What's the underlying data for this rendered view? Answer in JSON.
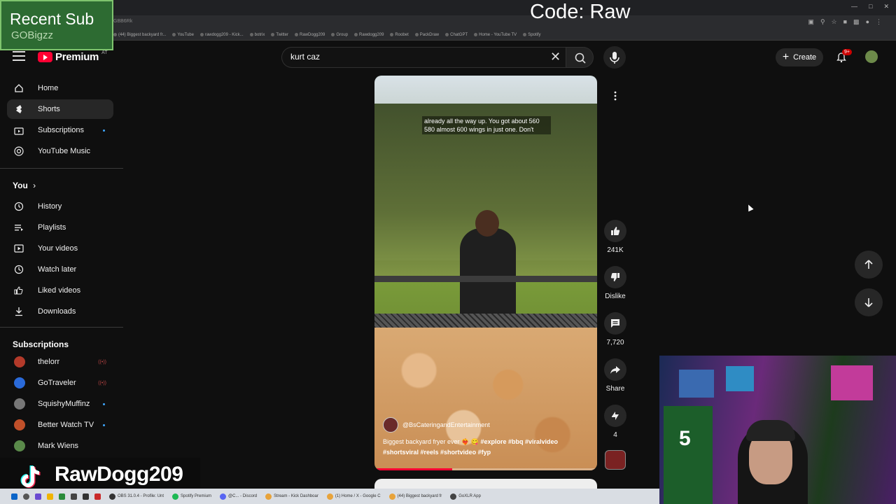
{
  "browser": {
    "url": "GBB6Rk",
    "bookmarks": [
      "(44) Biggest backyard fr...",
      "YouTube",
      "rawdogg209 - Kick...",
      "botrix",
      "Twitter",
      "RawDogg209",
      "Group",
      "Rawdogg209",
      "Roobet",
      "PackDraw",
      "ChatGPT",
      "Home - YouTube TV",
      "Spotify"
    ]
  },
  "overlays": {
    "recent_sub_title": "Recent Sub",
    "recent_sub_name": "GOBigzz",
    "code_label": "Code: Raw",
    "tiktok_handle": "RawDogg209"
  },
  "header": {
    "logo_text": "Premium",
    "region": "AT",
    "search_value": "kurt caz",
    "create_label": "Create",
    "notif_count": "9+"
  },
  "sidebar": {
    "main": [
      {
        "label": "Home",
        "icon": "home-icon"
      },
      {
        "label": "Shorts",
        "icon": "shorts-icon"
      },
      {
        "label": "Subscriptions",
        "icon": "subscriptions-icon"
      },
      {
        "label": "YouTube Music",
        "icon": "music-icon"
      }
    ],
    "you_heading": "You",
    "you_items": [
      {
        "label": "History"
      },
      {
        "label": "Playlists"
      },
      {
        "label": "Your videos"
      },
      {
        "label": "Watch later"
      },
      {
        "label": "Liked videos"
      },
      {
        "label": "Downloads"
      }
    ],
    "subs_heading": "Subscriptions",
    "subscriptions": [
      {
        "label": "thelorr",
        "color": "#b33a2a"
      },
      {
        "label": "GoTraveler",
        "color": "#2a6ad9"
      },
      {
        "label": "SquishyMuffinz",
        "color": "#777777"
      },
      {
        "label": "Better Watch TV",
        "color": "#c0502a"
      },
      {
        "label": "Mark Wiens",
        "color": "#5a8a4a"
      }
    ]
  },
  "short": {
    "caption": "already all the way up. You got about 560 580 almost 600 wings in just one. Don't",
    "channel": "@BsCateringandEntertainment",
    "desc_text": "Biggest backyard fryer ever ❤️‍🔥 😋 ",
    "desc_tags1": "#explore #bbq #viralvideo",
    "desc_tags2": "#shortsviral #reels #shortvideo #fyp",
    "progress": 0.35
  },
  "actions": {
    "likes": "241K",
    "dislike_label": "Dislike",
    "comments": "7,720",
    "share_label": "Share",
    "remix_count": "4"
  },
  "taskbar": {
    "apps": [
      "OBS 31.0.4 - Profile: Unt",
      "Spotify Premium",
      "@C... - Discord",
      "Stream - Kick Dashboar",
      "(1) Home / X - Google C",
      "(44) Biggest backyard fr",
      "GoXLR App"
    ]
  }
}
